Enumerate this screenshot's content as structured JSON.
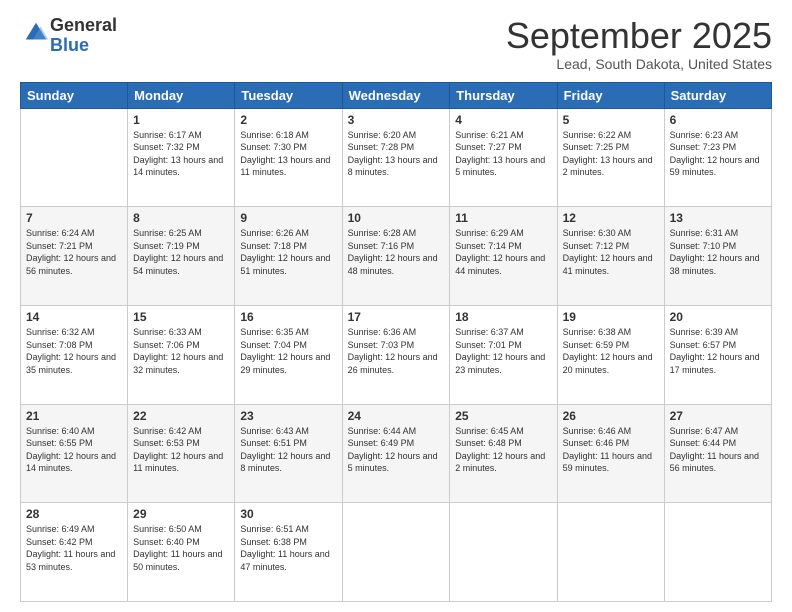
{
  "header": {
    "logo_general": "General",
    "logo_blue": "Blue",
    "month_title": "September 2025",
    "location": "Lead, South Dakota, United States"
  },
  "days_of_week": [
    "Sunday",
    "Monday",
    "Tuesday",
    "Wednesday",
    "Thursday",
    "Friday",
    "Saturday"
  ],
  "weeks": [
    [
      {
        "day": "",
        "sunrise": "",
        "sunset": "",
        "daylight": ""
      },
      {
        "day": "1",
        "sunrise": "Sunrise: 6:17 AM",
        "sunset": "Sunset: 7:32 PM",
        "daylight": "Daylight: 13 hours and 14 minutes."
      },
      {
        "day": "2",
        "sunrise": "Sunrise: 6:18 AM",
        "sunset": "Sunset: 7:30 PM",
        "daylight": "Daylight: 13 hours and 11 minutes."
      },
      {
        "day": "3",
        "sunrise": "Sunrise: 6:20 AM",
        "sunset": "Sunset: 7:28 PM",
        "daylight": "Daylight: 13 hours and 8 minutes."
      },
      {
        "day": "4",
        "sunrise": "Sunrise: 6:21 AM",
        "sunset": "Sunset: 7:27 PM",
        "daylight": "Daylight: 13 hours and 5 minutes."
      },
      {
        "day": "5",
        "sunrise": "Sunrise: 6:22 AM",
        "sunset": "Sunset: 7:25 PM",
        "daylight": "Daylight: 13 hours and 2 minutes."
      },
      {
        "day": "6",
        "sunrise": "Sunrise: 6:23 AM",
        "sunset": "Sunset: 7:23 PM",
        "daylight": "Daylight: 12 hours and 59 minutes."
      }
    ],
    [
      {
        "day": "7",
        "sunrise": "Sunrise: 6:24 AM",
        "sunset": "Sunset: 7:21 PM",
        "daylight": "Daylight: 12 hours and 56 minutes."
      },
      {
        "day": "8",
        "sunrise": "Sunrise: 6:25 AM",
        "sunset": "Sunset: 7:19 PM",
        "daylight": "Daylight: 12 hours and 54 minutes."
      },
      {
        "day": "9",
        "sunrise": "Sunrise: 6:26 AM",
        "sunset": "Sunset: 7:18 PM",
        "daylight": "Daylight: 12 hours and 51 minutes."
      },
      {
        "day": "10",
        "sunrise": "Sunrise: 6:28 AM",
        "sunset": "Sunset: 7:16 PM",
        "daylight": "Daylight: 12 hours and 48 minutes."
      },
      {
        "day": "11",
        "sunrise": "Sunrise: 6:29 AM",
        "sunset": "Sunset: 7:14 PM",
        "daylight": "Daylight: 12 hours and 44 minutes."
      },
      {
        "day": "12",
        "sunrise": "Sunrise: 6:30 AM",
        "sunset": "Sunset: 7:12 PM",
        "daylight": "Daylight: 12 hours and 41 minutes."
      },
      {
        "day": "13",
        "sunrise": "Sunrise: 6:31 AM",
        "sunset": "Sunset: 7:10 PM",
        "daylight": "Daylight: 12 hours and 38 minutes."
      }
    ],
    [
      {
        "day": "14",
        "sunrise": "Sunrise: 6:32 AM",
        "sunset": "Sunset: 7:08 PM",
        "daylight": "Daylight: 12 hours and 35 minutes."
      },
      {
        "day": "15",
        "sunrise": "Sunrise: 6:33 AM",
        "sunset": "Sunset: 7:06 PM",
        "daylight": "Daylight: 12 hours and 32 minutes."
      },
      {
        "day": "16",
        "sunrise": "Sunrise: 6:35 AM",
        "sunset": "Sunset: 7:04 PM",
        "daylight": "Daylight: 12 hours and 29 minutes."
      },
      {
        "day": "17",
        "sunrise": "Sunrise: 6:36 AM",
        "sunset": "Sunset: 7:03 PM",
        "daylight": "Daylight: 12 hours and 26 minutes."
      },
      {
        "day": "18",
        "sunrise": "Sunrise: 6:37 AM",
        "sunset": "Sunset: 7:01 PM",
        "daylight": "Daylight: 12 hours and 23 minutes."
      },
      {
        "day": "19",
        "sunrise": "Sunrise: 6:38 AM",
        "sunset": "Sunset: 6:59 PM",
        "daylight": "Daylight: 12 hours and 20 minutes."
      },
      {
        "day": "20",
        "sunrise": "Sunrise: 6:39 AM",
        "sunset": "Sunset: 6:57 PM",
        "daylight": "Daylight: 12 hours and 17 minutes."
      }
    ],
    [
      {
        "day": "21",
        "sunrise": "Sunrise: 6:40 AM",
        "sunset": "Sunset: 6:55 PM",
        "daylight": "Daylight: 12 hours and 14 minutes."
      },
      {
        "day": "22",
        "sunrise": "Sunrise: 6:42 AM",
        "sunset": "Sunset: 6:53 PM",
        "daylight": "Daylight: 12 hours and 11 minutes."
      },
      {
        "day": "23",
        "sunrise": "Sunrise: 6:43 AM",
        "sunset": "Sunset: 6:51 PM",
        "daylight": "Daylight: 12 hours and 8 minutes."
      },
      {
        "day": "24",
        "sunrise": "Sunrise: 6:44 AM",
        "sunset": "Sunset: 6:49 PM",
        "daylight": "Daylight: 12 hours and 5 minutes."
      },
      {
        "day": "25",
        "sunrise": "Sunrise: 6:45 AM",
        "sunset": "Sunset: 6:48 PM",
        "daylight": "Daylight: 12 hours and 2 minutes."
      },
      {
        "day": "26",
        "sunrise": "Sunrise: 6:46 AM",
        "sunset": "Sunset: 6:46 PM",
        "daylight": "Daylight: 11 hours and 59 minutes."
      },
      {
        "day": "27",
        "sunrise": "Sunrise: 6:47 AM",
        "sunset": "Sunset: 6:44 PM",
        "daylight": "Daylight: 11 hours and 56 minutes."
      }
    ],
    [
      {
        "day": "28",
        "sunrise": "Sunrise: 6:49 AM",
        "sunset": "Sunset: 6:42 PM",
        "daylight": "Daylight: 11 hours and 53 minutes."
      },
      {
        "day": "29",
        "sunrise": "Sunrise: 6:50 AM",
        "sunset": "Sunset: 6:40 PM",
        "daylight": "Daylight: 11 hours and 50 minutes."
      },
      {
        "day": "30",
        "sunrise": "Sunrise: 6:51 AM",
        "sunset": "Sunset: 6:38 PM",
        "daylight": "Daylight: 11 hours and 47 minutes."
      },
      {
        "day": "",
        "sunrise": "",
        "sunset": "",
        "daylight": ""
      },
      {
        "day": "",
        "sunrise": "",
        "sunset": "",
        "daylight": ""
      },
      {
        "day": "",
        "sunrise": "",
        "sunset": "",
        "daylight": ""
      },
      {
        "day": "",
        "sunrise": "",
        "sunset": "",
        "daylight": ""
      }
    ]
  ]
}
